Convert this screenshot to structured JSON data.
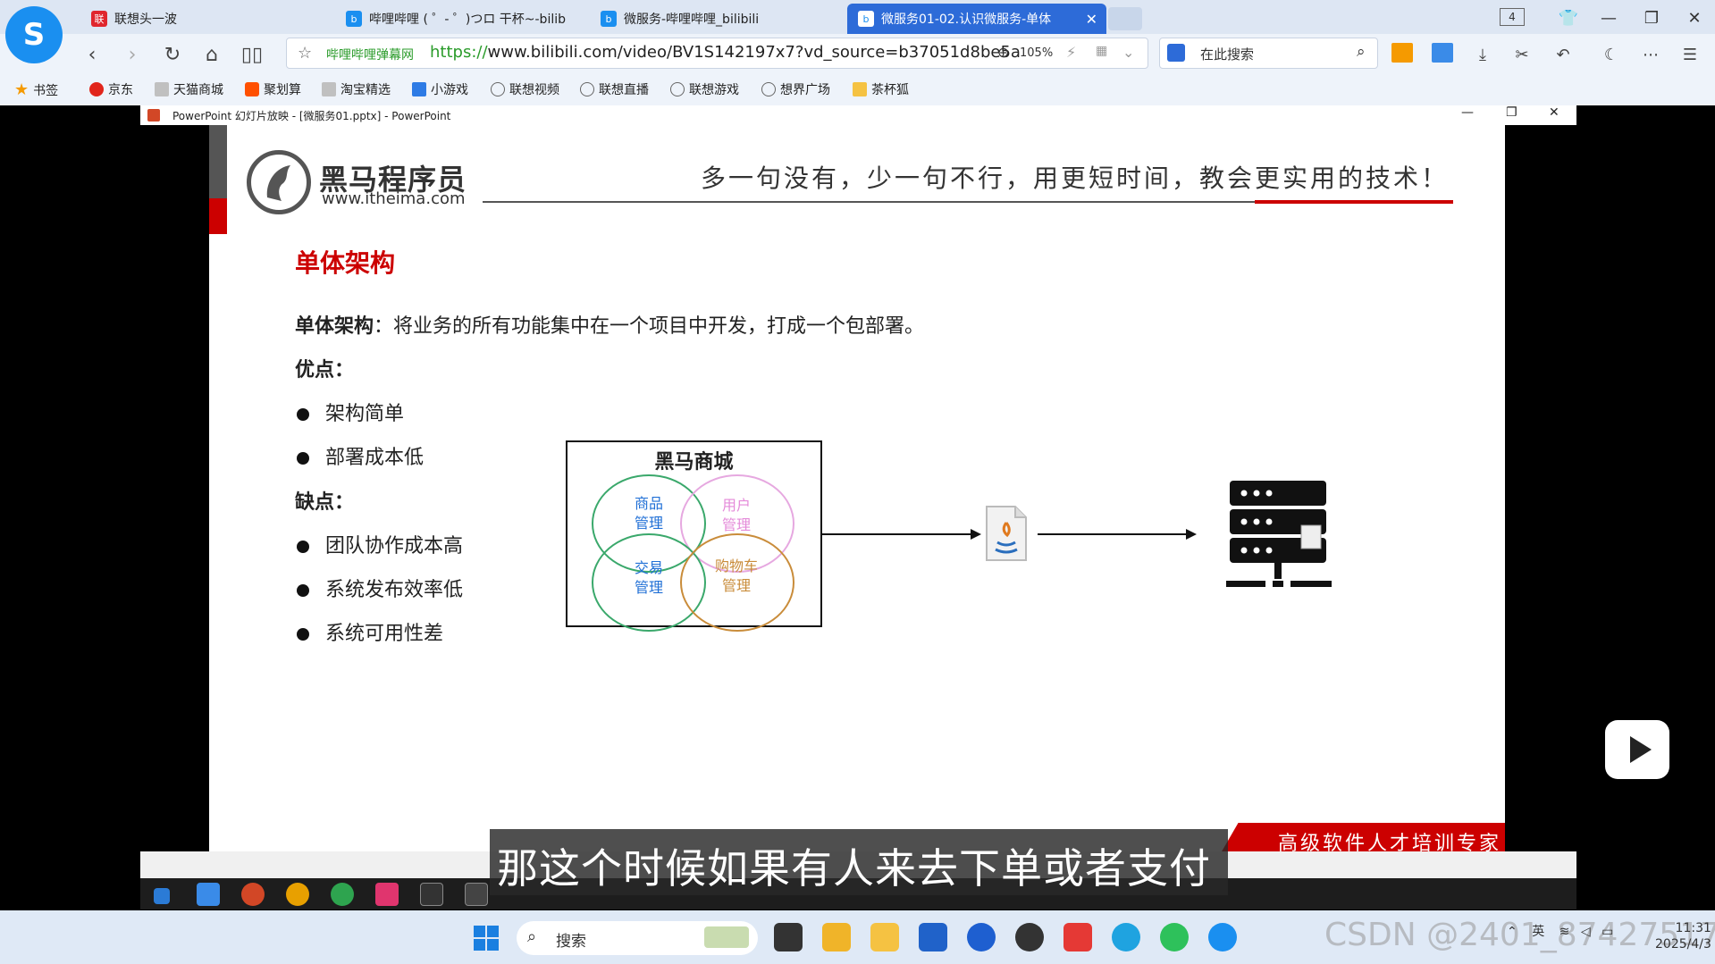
{
  "browser": {
    "tabs": [
      {
        "label": "联想头一波",
        "icon": "lenovo-news-icon",
        "color": "#e0262d"
      },
      {
        "label": "哔哩哔哩 ( ゜- ゜)つロ 干杯~-bilib",
        "icon": "bilibili-icon",
        "color": "#1a8ff0"
      },
      {
        "label": "微服务-哔哩哔哩_bilibili",
        "icon": "bilibili-icon",
        "color": "#1a8ff0"
      },
      {
        "label": "微服务01-02.认识微服务-单体",
        "icon": "bilibili-icon",
        "color": "#1a8ff0"
      }
    ],
    "tab_count": "4",
    "address": {
      "site_name": "哔哩哔哩弹幕网",
      "scheme": "https://",
      "url_rest": "www.bilibili.com/video/BV1S142197x7?vd_source=b37051d8be5a",
      "zoom": "105%"
    },
    "search_placeholder": "在此搜索",
    "bookmarks": [
      {
        "label": "书签",
        "icon": "star-icon",
        "color": "#f59a00"
      },
      {
        "label": "京东",
        "icon": "jd-icon",
        "color": "#e1251b"
      },
      {
        "label": "天猫商城",
        "icon": "tmall-icon",
        "color": "#c0c0c0"
      },
      {
        "label": "聚划算",
        "icon": "juhuasuan-icon",
        "color": "#ff5000"
      },
      {
        "label": "淘宝精选",
        "icon": "taobao-icon",
        "color": "#c0c0c0"
      },
      {
        "label": "小游戏",
        "icon": "game-icon",
        "color": "#2e7be5"
      },
      {
        "label": "联想视频",
        "icon": "globe-icon",
        "color": "#666666"
      },
      {
        "label": "联想直播",
        "icon": "globe-icon",
        "color": "#666666"
      },
      {
        "label": "联想游戏",
        "icon": "globe-icon",
        "color": "#666666"
      },
      {
        "label": "想界广场",
        "icon": "globe-icon",
        "color": "#666666"
      },
      {
        "label": "茶杯狐",
        "icon": "folder-icon",
        "color": "#f5c242"
      }
    ]
  },
  "ppt_window": {
    "title": "PowerPoint 幻灯片放映 - [微服务01.pptx] - PowerPoint"
  },
  "slide": {
    "brand_name": "黑马程序员",
    "brand_url": "www.itheima.com",
    "slogan": "多一句没有，少一句不行，用更短时间，教会更实用的技术！",
    "title": "单体架构",
    "definition_term": "单体架构",
    "definition_text": "：将业务的所有功能集中在一个项目中开发，打成一个包部署。",
    "pros_heading": "优点：",
    "pros": [
      "架构简单",
      "部署成本低"
    ],
    "cons_heading": "缺点：",
    "cons": [
      "团队协作成本高",
      "系统发布效率低",
      "系统可用性差"
    ],
    "venn": {
      "title": "黑马商城",
      "modules": [
        {
          "label": "商品\n管理",
          "color": "#3aa86b",
          "text_color": "#1f6fd6"
        },
        {
          "label": "用户\n管理",
          "color": "#e6a8e0",
          "text_color": "#e48ad9"
        },
        {
          "label": "交易\n管理",
          "color": "#3aa86b",
          "text_color": "#1f6fd6"
        },
        {
          "label": "购物车\n管理",
          "color": "#c98c3a",
          "text_color": "#c98c3a"
        }
      ]
    },
    "banner_text": "高级软件人才培训专家"
  },
  "subtitle": "那这个时候如果有人来去下单或者支付",
  "taskbar": {
    "search_label": "搜索",
    "tray_lang": "英",
    "time": "11:31",
    "date": "2025/4/3"
  },
  "watermark": "CSDN @2401_87427517",
  "colors": {
    "accent_blue": "#2d6bd8",
    "brand_red": "#cc0000"
  }
}
